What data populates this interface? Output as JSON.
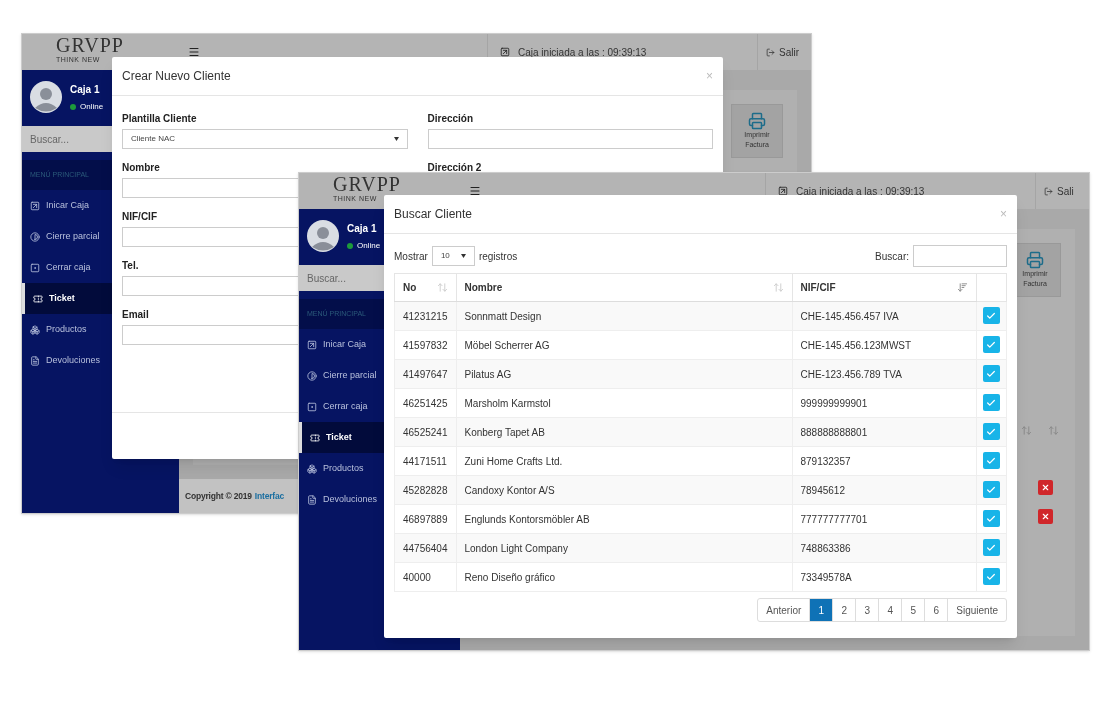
{
  "windows": [
    {
      "logo": {
        "name": "GRVPP",
        "tagline": "THINK NEW"
      },
      "header": {
        "session": "Caja iniciada a las : 09:39:13",
        "logout": "Salir"
      },
      "user": {
        "name": "Caja 1",
        "status": "Online",
        "online": true
      },
      "search_placeholder": "Buscar...",
      "menu_header": "MENÚ PRINCIPAL",
      "menu": [
        {
          "label": "Inicar Caja",
          "selected": false
        },
        {
          "label": "Cierre parcial",
          "selected": false
        },
        {
          "label": "Cerrar caja",
          "selected": false
        },
        {
          "label": "Ticket",
          "selected": true
        },
        {
          "label": "Productos",
          "selected": false
        },
        {
          "label": "Devoluciones",
          "selected": false
        }
      ],
      "content": {
        "print_label": "Imprimir Factura"
      },
      "footer": {
        "text": "Copyright © 2019",
        "link": "Interfac"
      },
      "modal": {
        "kind": "form",
        "title": "Crear Nuevo Cliente",
        "close": "×",
        "columns": [
          [
            {
              "label": "Plantilla Cliente",
              "kind": "select",
              "value": "Cliente NAC"
            },
            {
              "label": "Nombre",
              "kind": "text"
            },
            {
              "label": "NIF/CIF",
              "kind": "text"
            },
            {
              "label": "Tel.",
              "kind": "text"
            },
            {
              "label": "Email",
              "kind": "text"
            }
          ],
          [
            {
              "label": "Dirección",
              "kind": "text"
            },
            {
              "label": "Dirección 2",
              "kind": "label_only"
            }
          ]
        ]
      }
    },
    {
      "logo": {
        "name": "GRVPP",
        "tagline": "THINK NEW"
      },
      "header": {
        "session": "Caja iniciada a las : 09:39:13",
        "logout": "Sali"
      },
      "user": {
        "name": "Caja 1",
        "status": "Online",
        "online": true
      },
      "search_placeholder": "Buscar...",
      "menu_header": "MENÚ PRINCIPAL",
      "menu": [
        {
          "label": "Inicar Caja",
          "selected": false
        },
        {
          "label": "Cierre parcial",
          "selected": false
        },
        {
          "label": "Cerrar caja",
          "selected": false
        },
        {
          "label": "Ticket",
          "selected": true
        },
        {
          "label": "Productos",
          "selected": false
        },
        {
          "label": "Devoluciones",
          "selected": false
        }
      ],
      "content": {
        "print_label": "Imprimir Factura",
        "item_rows": [
          {
            "removable": true
          },
          {
            "removable": true
          }
        ]
      },
      "modal": {
        "kind": "table",
        "title": "Buscar Cliente",
        "close": "×",
        "length": {
          "before": "Mostrar",
          "value": "10",
          "after": "registros"
        },
        "search_label": "Buscar:",
        "columns": [
          {
            "label": "No",
            "sorted": false
          },
          {
            "label": "Nombre",
            "sorted": false
          },
          {
            "label": "NIF/CIF",
            "sorted": true
          }
        ],
        "rows": [
          [
            "41231215",
            "Sonnmatt Design",
            "CHE-145.456.457 IVA"
          ],
          [
            "41597832",
            "Möbel Scherrer AG",
            "CHE-145.456.123MWST"
          ],
          [
            "41497647",
            "Pilatus AG",
            "CHE-123.456.789 TVA"
          ],
          [
            "46251425",
            "Marsholm Karmstol",
            "999999999901"
          ],
          [
            "46525241",
            "Konberg Tapet AB",
            "888888888801"
          ],
          [
            "44171511",
            "Zuni Home Crafts Ltd.",
            "879132357"
          ],
          [
            "45282828",
            "Candoxy Kontor A/S",
            "78945612"
          ],
          [
            "46897889",
            "Englunds Kontorsmöbler AB",
            "777777777701"
          ],
          [
            "44756404",
            "London Light Company",
            "748863386"
          ],
          [
            "40000",
            "Reno Diseño gráfico",
            "73349578A"
          ]
        ],
        "pagination": {
          "previous": "Anterior",
          "next": "Siguiente",
          "pages": [
            {
              "label": "1",
              "selected": true
            },
            {
              "label": "2",
              "selected": false
            },
            {
              "label": "3",
              "selected": false
            },
            {
              "label": "4",
              "selected": false
            },
            {
              "label": "5",
              "selected": false
            },
            {
              "label": "6",
              "selected": false
            }
          ]
        }
      }
    }
  ]
}
